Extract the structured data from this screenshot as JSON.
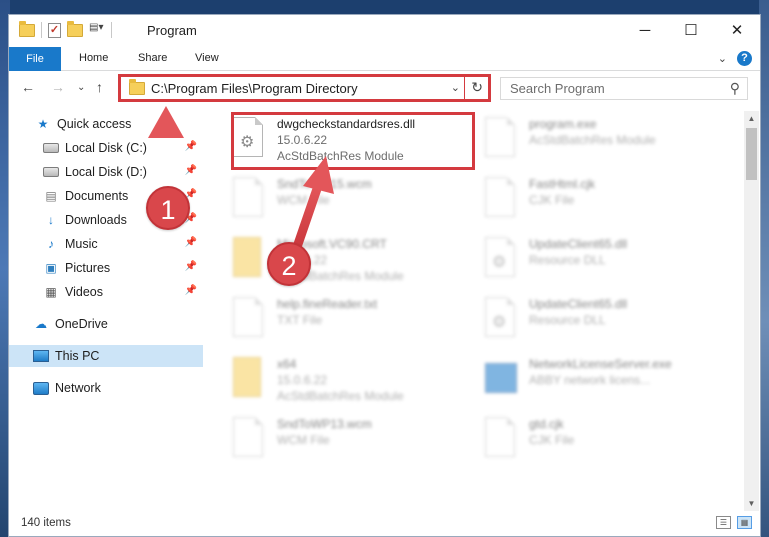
{
  "window": {
    "title": "Program",
    "controls": {
      "minimize": "─",
      "maximize": "☐",
      "close": "✕"
    }
  },
  "ribbon": {
    "file": "File",
    "tabs": [
      "Home",
      "Share",
      "View"
    ],
    "expand": "⌄",
    "help": "?"
  },
  "nav": {
    "back": "←",
    "forward": "→",
    "recent": "⌄",
    "up": "↑",
    "address": "C:\\Program Files\\Program Directory",
    "address_dropdown": "⌄",
    "refresh": "↻",
    "search_placeholder": "Search Program",
    "search_icon": "⚲"
  },
  "sidebar": {
    "quick_access": "Quick access",
    "items": [
      {
        "label": "Local Disk (C:)",
        "icon": "drive-icon"
      },
      {
        "label": "Local Disk (D:)",
        "icon": "drive-icon"
      },
      {
        "label": "Documents",
        "icon": "documents-icon"
      },
      {
        "label": "Downloads",
        "icon": "downloads-icon"
      },
      {
        "label": "Music",
        "icon": "music-icon"
      },
      {
        "label": "Pictures",
        "icon": "pictures-icon"
      },
      {
        "label": "Videos",
        "icon": "videos-icon"
      }
    ],
    "onedrive": "OneDrive",
    "this_pc": "This PC",
    "network": "Network"
  },
  "files": {
    "highlighted": {
      "name": "dwgcheckstandardsres.dll",
      "line2": "15.0.6.22",
      "line3": "AcStdBatchRes Module"
    },
    "left": [
      {
        "name": "SndToWP15.wcm",
        "type": "WCM File"
      },
      {
        "name": "Microsoft.VC90.CRT",
        "type": "AcStdBatchRes Module",
        "version": "15.0.6.22"
      },
      {
        "name": "help.fineReader.txt",
        "type": "TXT File"
      },
      {
        "name": "x64",
        "version": "15.0.6.22",
        "type": "AcStdBatchRes Module"
      },
      {
        "name": "SndToWP13.wcm",
        "type": "WCM File"
      }
    ],
    "right": [
      {
        "name": "program.exe",
        "type": "AcStdBatchRes Module"
      },
      {
        "name": "FastHtml.cjk",
        "type": "CJK File"
      },
      {
        "name": "UpdateClient65.dll",
        "type": "Resource DLL"
      },
      {
        "name": "UpdateClient65.dll",
        "type": "Resource DLL"
      },
      {
        "name": "NetworkLicenseServer.exe",
        "type": "ABBY network licens..."
      },
      {
        "name": "gtd.cjk",
        "type": "CJK File"
      }
    ]
  },
  "status": {
    "count": "140 items"
  },
  "annotations": {
    "step1": "1",
    "step2": "2"
  },
  "colors": {
    "accent": "#1979ca",
    "highlight": "#d43a3f",
    "selected": "#cce4f7"
  }
}
